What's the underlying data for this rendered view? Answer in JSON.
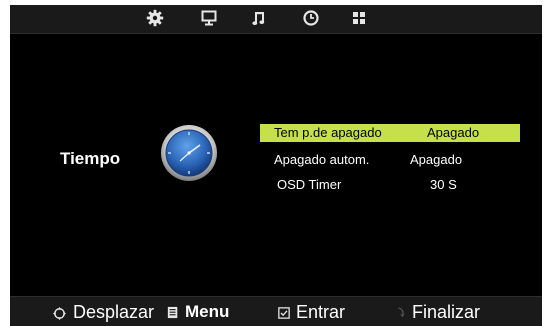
{
  "panel": {
    "title": "Tiempo",
    "icon": "clock-icon"
  },
  "top_icons": [
    "gear-icon",
    "monitor-icon",
    "music-note-icon",
    "clock-icon",
    "grid-icon"
  ],
  "menu": [
    {
      "label": "Tem p.de  apagado",
      "value": "Apagado",
      "selected": true
    },
    {
      "label": "Apagado autom.",
      "value": "Apagado",
      "selected": false
    },
    {
      "label": "OSD Timer",
      "value": "30  S",
      "selected": false
    }
  ],
  "hints": {
    "move": "Desplazar",
    "menu": "Menu",
    "enter": "Entrar",
    "exit": "Finalizar"
  },
  "colors": {
    "highlight": "#c6e04a",
    "background": "#000000",
    "bar": "#1a1a1a"
  }
}
